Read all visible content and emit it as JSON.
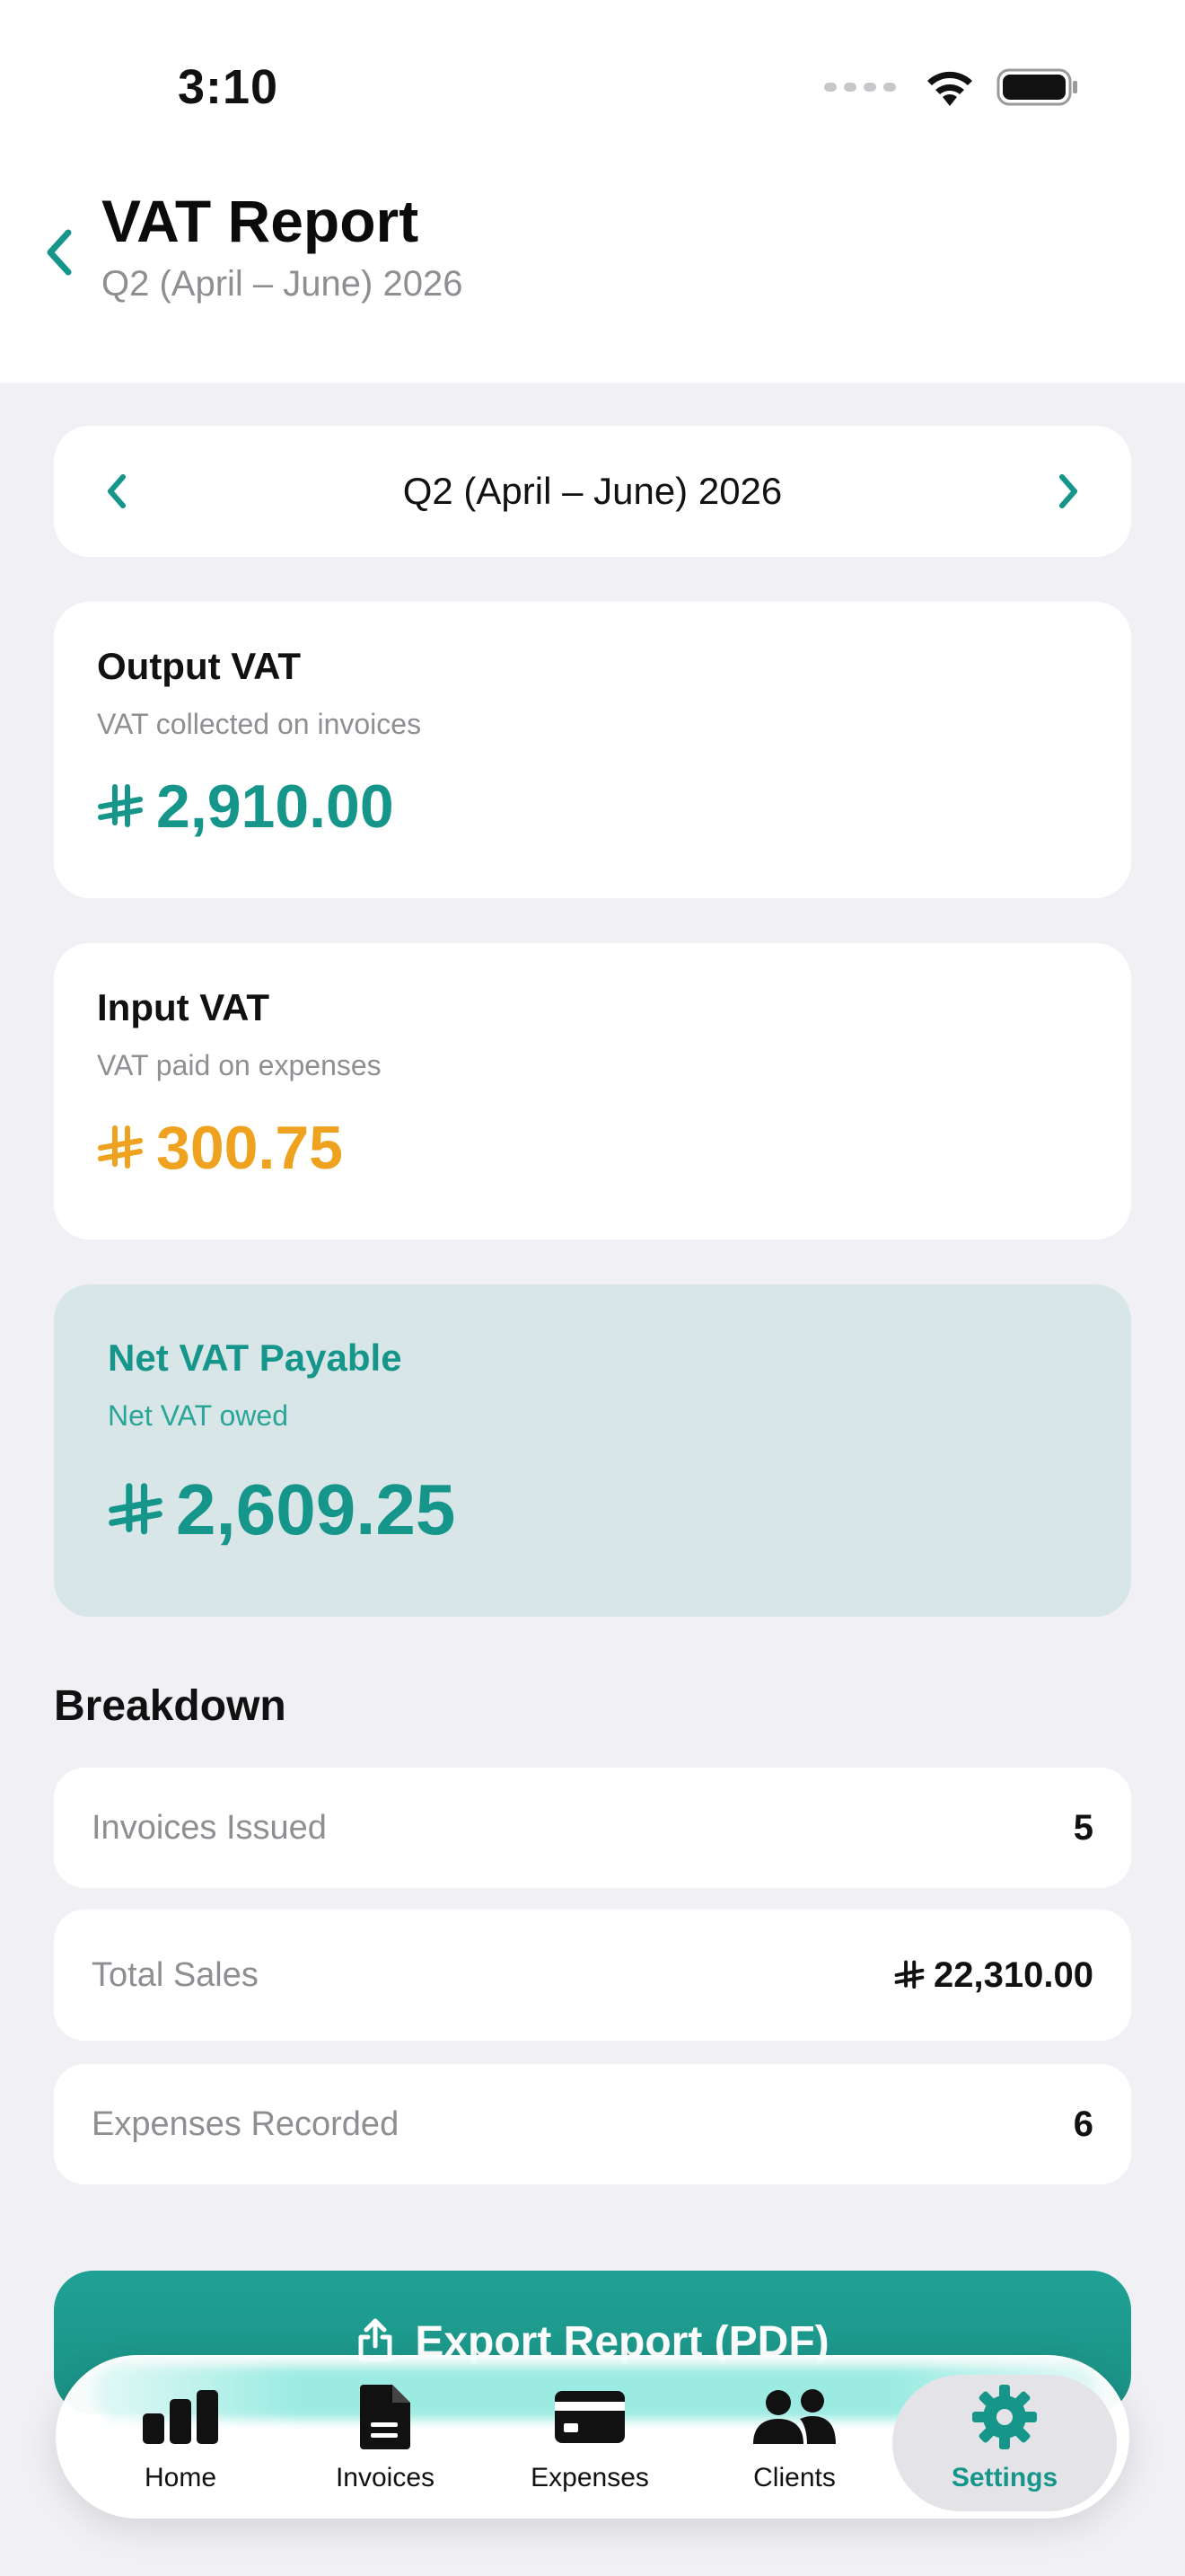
{
  "status": {
    "time": "3:10"
  },
  "header": {
    "title": "VAT Report",
    "subtitle": "Q2 (April – June) 2026"
  },
  "period": {
    "label": "Q2 (April – June) 2026"
  },
  "output_vat": {
    "title": "Output VAT",
    "subtitle": "VAT collected on invoices",
    "amount": "2,910.00"
  },
  "input_vat": {
    "title": "Input VAT",
    "subtitle": "VAT paid on expenses",
    "amount": "300.75"
  },
  "net_vat": {
    "title": "Net VAT Payable",
    "subtitle": "Net VAT owed",
    "amount": "2,609.25"
  },
  "breakdown": {
    "title": "Breakdown",
    "rows": [
      {
        "label": "Invoices Issued",
        "value": "5"
      },
      {
        "label": "Total Sales",
        "value": "22,310.00"
      },
      {
        "label": "Expenses Recorded",
        "value": "6"
      }
    ]
  },
  "export_button": {
    "label": "Export Report (PDF)"
  },
  "tabs": [
    {
      "label": "Home",
      "icon": "chart-bar-icon"
    },
    {
      "label": "Invoices",
      "icon": "document-icon"
    },
    {
      "label": "Expenses",
      "icon": "credit-card-icon"
    },
    {
      "label": "Clients",
      "icon": "people-icon"
    },
    {
      "label": "Settings",
      "icon": "gear-icon",
      "active": true
    }
  ],
  "colors": {
    "accent": "#16968a",
    "input_amount": "#eea21f",
    "net_card_bg": "#d8e6e8",
    "background": "#f0f0f5"
  }
}
